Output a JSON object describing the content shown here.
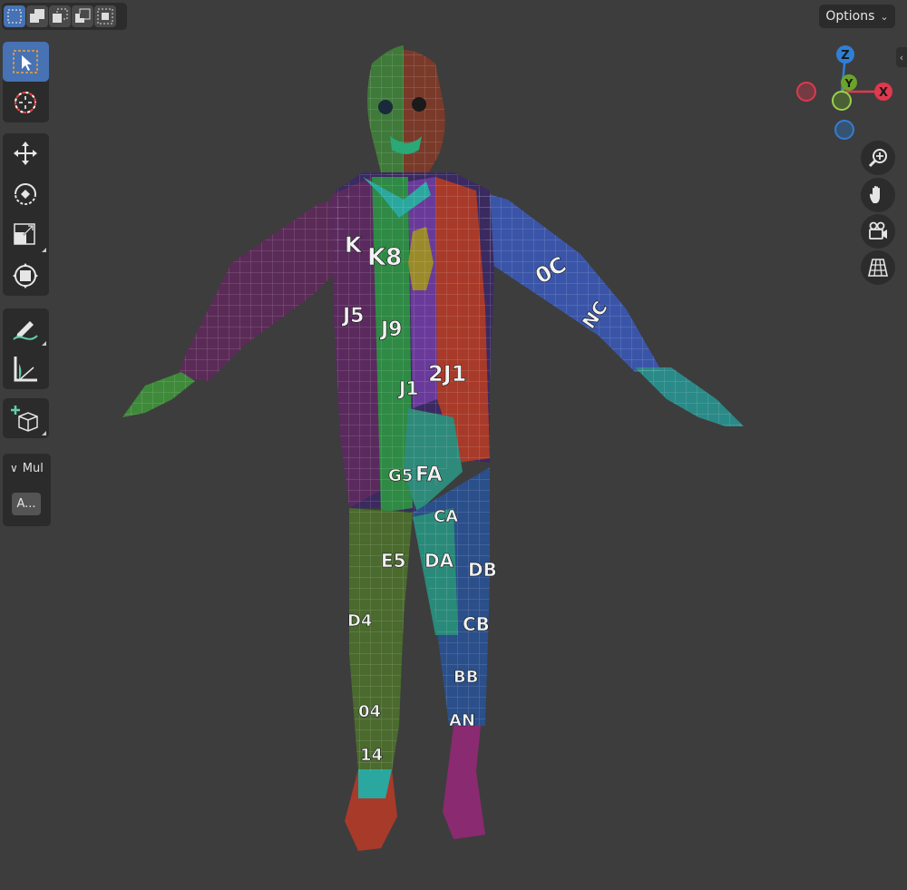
{
  "header": {
    "select_modes": [
      {
        "name": "select-new-icon",
        "active": true
      },
      {
        "name": "select-extend-icon",
        "active": false
      },
      {
        "name": "select-subtract-icon",
        "active": false
      },
      {
        "name": "select-invert-icon",
        "active": false
      },
      {
        "name": "select-intersect-icon",
        "active": false
      }
    ],
    "options_label": "Options"
  },
  "toolbar": {
    "tools": [
      {
        "name": "select-box-tool",
        "icon": "cursor-box-icon",
        "active": true
      },
      {
        "name": "cursor-tool",
        "icon": "3d-cursor-icon",
        "active": false
      },
      {
        "name": "move-tool",
        "icon": "move-arrows-icon",
        "active": false
      },
      {
        "name": "rotate-tool",
        "icon": "rotate-icon",
        "active": false
      },
      {
        "name": "scale-tool",
        "icon": "scale-icon",
        "active": false
      },
      {
        "name": "transform-tool",
        "icon": "transform-icon",
        "active": false
      },
      {
        "name": "annotate-tool",
        "icon": "annotate-pen-icon",
        "active": false
      },
      {
        "name": "measure-tool",
        "icon": "measure-ruler-icon",
        "active": false
      },
      {
        "name": "add-cube-tool",
        "icon": "add-cube-icon",
        "active": false
      }
    ]
  },
  "panel": {
    "title": "Mul",
    "button_label": "A..."
  },
  "gizmo": {
    "axes": [
      {
        "label": "Z",
        "color": "#2f7fd6"
      },
      {
        "label": "X",
        "color": "#e0384e"
      },
      {
        "label": "Y",
        "color": "#6aa42b"
      }
    ]
  },
  "navigation": [
    {
      "name": "zoom-button",
      "icon": "zoom-icon"
    },
    {
      "name": "pan-button",
      "icon": "hand-icon"
    },
    {
      "name": "camera-view-button",
      "icon": "camera-icon"
    },
    {
      "name": "ortho-toggle-button",
      "icon": "grid-perspective-icon"
    }
  ],
  "model_labels": [
    "K",
    "K8",
    "J5",
    "J9",
    "J1",
    "2J1",
    "0C",
    "FA",
    "G5",
    "CA",
    "E5",
    "DA",
    "DB",
    "CB",
    "BB",
    "D4",
    "04",
    "14",
    "AN",
    "NC"
  ],
  "colors": {
    "background": "#3d3d3d",
    "panel": "#2b2b2b",
    "accent": "#4772b3",
    "axis_x": "#e0384e",
    "axis_y": "#6aa42b",
    "axis_z": "#2f7fd6"
  }
}
